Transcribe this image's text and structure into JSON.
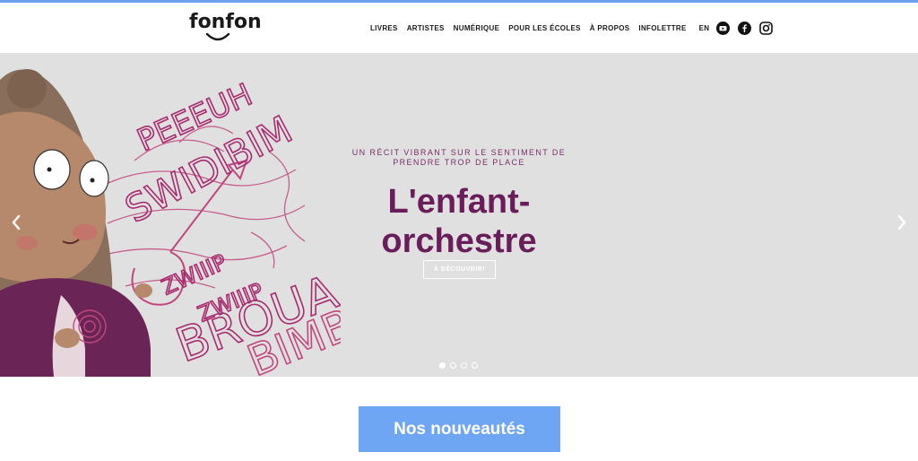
{
  "header": {
    "logo_text": "fonfon",
    "nav": [
      "LIVRES",
      "ARTISTES",
      "NUMÉRIQUE",
      "POUR LES ÉCOLES",
      "À PROPOS",
      "INFOLETTRE"
    ],
    "language": "EN",
    "social_icons": [
      "youtube-icon",
      "facebook-icon",
      "instagram-icon"
    ]
  },
  "hero": {
    "tagline": "UN RÉCIT VIBRANT SUR LE SENTIMENT DE PRENDRE TROP DE PLACE",
    "title": "L'enfant-orchestre",
    "cta": "À DÉCOUVRIR!",
    "illustration_words": [
      "PEEEUH",
      "SWIDIBIM",
      "ZWIIIP",
      "ZWIIIP",
      "BROUA",
      "BIMBAM"
    ],
    "slides_count": 4,
    "active_slide": 1
  },
  "main": {
    "new_releases_button": "Nos nouveautés"
  },
  "colors": {
    "accent_blue": "#6ea6f4",
    "title_purple": "#6a1d5b",
    "hero_bg": "#e0e0e0",
    "illustration_pink": "#c2477f"
  }
}
